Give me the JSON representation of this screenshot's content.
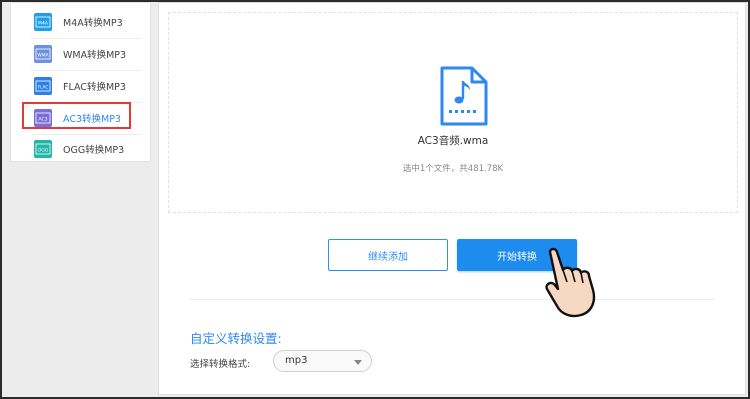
{
  "sidebar": {
    "items": [
      {
        "label": "M4A转换MP3",
        "icon": "m4a-file-icon",
        "icon_text": "M4A",
        "color": "#1ea0e8"
      },
      {
        "label": "WMA转换MP3",
        "icon": "wma-file-icon",
        "icon_text": "WMA",
        "color": "#6f8fe0"
      },
      {
        "label": "FLAC转换MP3",
        "icon": "flac-file-icon",
        "icon_text": "FLAC",
        "color": "#2f7fe6"
      },
      {
        "label": "AC3转换MP3",
        "icon": "ac3-file-icon",
        "icon_text": "AC3",
        "color": "#7a6fd8",
        "active": true
      },
      {
        "label": "OGG转换MP3",
        "icon": "ogg-file-icon",
        "icon_text": "OGG",
        "color": "#23b5a8"
      }
    ]
  },
  "file": {
    "name": "AC3音频.wma",
    "summary": "选中1个文件，共481.78K",
    "icon": "audio-file-icon"
  },
  "buttons": {
    "add_label": "继续添加",
    "start_label": "开始转换"
  },
  "settings": {
    "title": "自定义转换设置:",
    "format_label": "选择转换格式:",
    "format_value": "mp3"
  },
  "colors": {
    "accent": "#1e8bef",
    "highlight": "#e23a3a"
  }
}
